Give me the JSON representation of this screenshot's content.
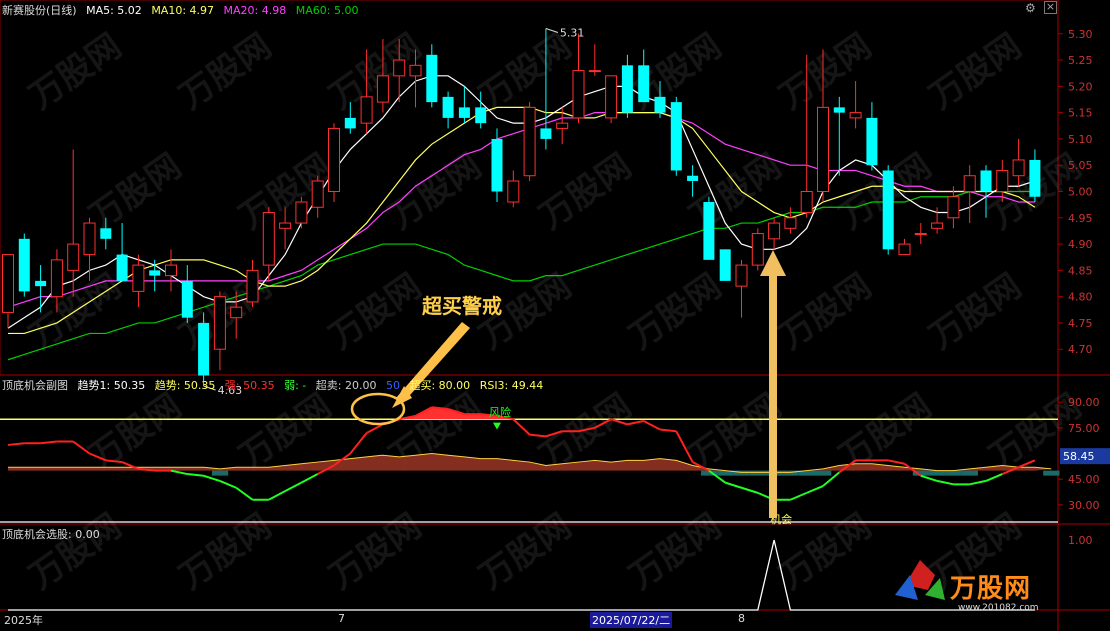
{
  "main_panel": {
    "title": "新赛股份(日线)",
    "ma5_label": "MA5: 5.02",
    "ma10_label": "MA10: 4.97",
    "ma20_label": "MA20: 4.98",
    "ma60_label": "MA60: 5.00",
    "price_ticks": [
      "5.30",
      "5.25",
      "5.20",
      "5.15",
      "5.10",
      "5.05",
      "5.00",
      "4.95",
      "4.90",
      "4.85",
      "4.80",
      "4.75",
      "4.70"
    ],
    "high_label": "5.31",
    "low_label": "4.63",
    "annotation_overbought": "超买警戒"
  },
  "sub_panel_1": {
    "title": "顶底机会副图",
    "label_trend1": "趋势1: 50.35",
    "label_trend": "趋势: 50.35",
    "label_strong": "强: 50.35",
    "label_weak": "弱: -",
    "label_oversold": "超卖: 20.00",
    "label_50": "50",
    "label_overbought": "超买: 80.00",
    "label_rsi3": "RSI3: 49.44",
    "ticks": [
      "90.00",
      "75.00",
      "45.00",
      "30.00"
    ],
    "current_value": "58.45",
    "signal_risk": "风险",
    "signal_chance": "机会"
  },
  "sub_panel_2": {
    "title": "顶底机会选股",
    "value": ": 0.00",
    "tick": "1.00"
  },
  "time_axis": {
    "label_year": "2025年",
    "label_7": "7",
    "label_date": "2025/07/22/二",
    "label_8": "8"
  },
  "watermark": {
    "brand": "万股网",
    "url": "www.201082.com"
  },
  "colors": {
    "up": "#ff3030",
    "down": "#00ffff",
    "ma5": "#ffffff",
    "ma10": "#ffff60",
    "ma20": "#ff40ff",
    "ma60": "#00d000"
  },
  "chart_data": [
    {
      "type": "candlestick",
      "title": "新赛股份(日线)",
      "ylim": [
        4.67,
        5.33
      ],
      "candles": [
        {
          "o": 4.77,
          "h": 4.88,
          "l": 4.74,
          "c": 4.88
        },
        {
          "o": 4.91,
          "h": 4.92,
          "l": 4.8,
          "c": 4.81
        },
        {
          "o": 4.83,
          "h": 4.86,
          "l": 4.77,
          "c": 4.82
        },
        {
          "o": 4.8,
          "h": 4.89,
          "l": 4.77,
          "c": 4.87
        },
        {
          "o": 4.85,
          "h": 5.08,
          "l": 4.8,
          "c": 4.9
        },
        {
          "o": 4.88,
          "h": 4.95,
          "l": 4.83,
          "c": 4.94
        },
        {
          "o": 4.93,
          "h": 4.95,
          "l": 4.89,
          "c": 4.91
        },
        {
          "o": 4.88,
          "h": 4.94,
          "l": 4.83,
          "c": 4.83
        },
        {
          "o": 4.81,
          "h": 4.88,
          "l": 4.78,
          "c": 4.86
        },
        {
          "o": 4.85,
          "h": 4.87,
          "l": 4.81,
          "c": 4.84
        },
        {
          "o": 4.84,
          "h": 4.89,
          "l": 4.81,
          "c": 4.86
        },
        {
          "o": 4.83,
          "h": 4.86,
          "l": 4.75,
          "c": 4.76
        },
        {
          "o": 4.75,
          "h": 4.77,
          "l": 4.63,
          "c": 4.65
        },
        {
          "o": 4.7,
          "h": 4.81,
          "l": 4.66,
          "c": 4.8
        },
        {
          "o": 4.76,
          "h": 4.81,
          "l": 4.72,
          "c": 4.78
        },
        {
          "o": 4.79,
          "h": 4.87,
          "l": 4.78,
          "c": 4.85
        },
        {
          "o": 4.86,
          "h": 4.97,
          "l": 4.83,
          "c": 4.96
        },
        {
          "o": 4.93,
          "h": 4.97,
          "l": 4.89,
          "c": 4.94
        },
        {
          "o": 4.94,
          "h": 4.99,
          "l": 4.93,
          "c": 4.98
        },
        {
          "o": 4.97,
          "h": 5.03,
          "l": 4.95,
          "c": 5.02
        },
        {
          "o": 5.0,
          "h": 5.13,
          "l": 4.98,
          "c": 5.12
        },
        {
          "o": 5.14,
          "h": 5.17,
          "l": 5.11,
          "c": 5.12
        },
        {
          "o": 5.13,
          "h": 5.27,
          "l": 5.11,
          "c": 5.18
        },
        {
          "o": 5.17,
          "h": 5.29,
          "l": 5.15,
          "c": 5.22
        },
        {
          "o": 5.22,
          "h": 5.29,
          "l": 5.17,
          "c": 5.25
        },
        {
          "o": 5.22,
          "h": 5.27,
          "l": 5.16,
          "c": 5.24
        },
        {
          "o": 5.26,
          "h": 5.28,
          "l": 5.16,
          "c": 5.17
        },
        {
          "o": 5.18,
          "h": 5.19,
          "l": 5.12,
          "c": 5.14
        },
        {
          "o": 5.16,
          "h": 5.2,
          "l": 5.13,
          "c": 5.14
        },
        {
          "o": 5.16,
          "h": 5.19,
          "l": 5.12,
          "c": 5.13
        },
        {
          "o": 5.1,
          "h": 5.12,
          "l": 4.98,
          "c": 5.0
        },
        {
          "o": 4.98,
          "h": 5.04,
          "l": 4.97,
          "c": 5.02
        },
        {
          "o": 5.03,
          "h": 5.17,
          "l": 5.02,
          "c": 5.16
        },
        {
          "o": 5.12,
          "h": 5.31,
          "l": 5.08,
          "c": 5.1
        },
        {
          "o": 5.12,
          "h": 5.16,
          "l": 5.09,
          "c": 5.13
        },
        {
          "o": 5.14,
          "h": 5.3,
          "l": 5.13,
          "c": 5.23
        },
        {
          "o": 5.23,
          "h": 5.28,
          "l": 5.22,
          "c": 5.23
        },
        {
          "o": 5.14,
          "h": 5.22,
          "l": 5.13,
          "c": 5.22
        },
        {
          "o": 5.24,
          "h": 5.26,
          "l": 5.14,
          "c": 5.15
        },
        {
          "o": 5.24,
          "h": 5.27,
          "l": 5.17,
          "c": 5.17
        },
        {
          "o": 5.18,
          "h": 5.21,
          "l": 5.14,
          "c": 5.15
        },
        {
          "o": 5.17,
          "h": 5.18,
          "l": 5.03,
          "c": 5.04
        },
        {
          "o": 5.03,
          "h": 5.05,
          "l": 4.99,
          "c": 5.02
        },
        {
          "o": 4.98,
          "h": 4.99,
          "l": 4.87,
          "c": 4.87
        },
        {
          "o": 4.89,
          "h": 4.89,
          "l": 4.83,
          "c": 4.83
        },
        {
          "o": 4.82,
          "h": 4.87,
          "l": 4.76,
          "c": 4.86
        },
        {
          "o": 4.86,
          "h": 4.93,
          "l": 4.85,
          "c": 4.92
        },
        {
          "o": 4.91,
          "h": 4.95,
          "l": 4.89,
          "c": 4.94
        },
        {
          "o": 4.93,
          "h": 4.97,
          "l": 4.92,
          "c": 4.95
        },
        {
          "o": 4.96,
          "h": 5.26,
          "l": 4.95,
          "c": 5.0
        },
        {
          "o": 5.0,
          "h": 5.27,
          "l": 4.98,
          "c": 5.16
        },
        {
          "o": 5.16,
          "h": 5.18,
          "l": 5.03,
          "c": 5.15
        },
        {
          "o": 5.14,
          "h": 5.21,
          "l": 5.12,
          "c": 5.15
        },
        {
          "o": 5.14,
          "h": 5.17,
          "l": 5.04,
          "c": 5.05
        },
        {
          "o": 5.04,
          "h": 5.05,
          "l": 4.88,
          "c": 4.89
        },
        {
          "o": 4.88,
          "h": 4.91,
          "l": 4.88,
          "c": 4.9
        },
        {
          "o": 4.92,
          "h": 4.94,
          "l": 4.9,
          "c": 4.92
        },
        {
          "o": 4.93,
          "h": 4.97,
          "l": 4.92,
          "c": 4.94
        },
        {
          "o": 4.95,
          "h": 5.01,
          "l": 4.93,
          "c": 4.99
        },
        {
          "o": 5.0,
          "h": 5.05,
          "l": 4.94,
          "c": 5.03
        },
        {
          "o": 5.04,
          "h": 5.05,
          "l": 4.95,
          "c": 5.0
        },
        {
          "o": 5.0,
          "h": 5.06,
          "l": 4.98,
          "c": 5.04
        },
        {
          "o": 5.03,
          "h": 5.1,
          "l": 5.01,
          "c": 5.06
        },
        {
          "o": 5.06,
          "h": 5.08,
          "l": 4.98,
          "c": 4.99
        }
      ],
      "ma5": [
        4.74,
        4.76,
        4.78,
        4.82,
        4.83,
        4.85,
        4.86,
        4.88,
        4.87,
        4.86,
        4.84,
        4.82,
        4.8,
        4.79,
        4.79,
        4.8,
        4.84,
        4.88,
        4.94,
        4.99,
        5.04,
        5.08,
        5.11,
        5.14,
        5.18,
        5.21,
        5.22,
        5.22,
        5.2,
        5.17,
        5.14,
        5.13,
        5.13,
        5.14,
        5.16,
        5.18,
        5.19,
        5.2,
        5.2,
        5.18,
        5.17,
        5.15,
        5.08,
        5.01,
        4.94,
        4.9,
        4.89,
        4.89,
        4.9,
        4.93,
        5.0,
        5.04,
        5.06,
        5.05,
        5.02,
        4.99,
        4.97,
        4.96,
        4.96,
        4.97,
        4.99,
        5.01,
        5.01,
        5.02
      ],
      "ma10": [
        4.73,
        4.73,
        4.74,
        4.75,
        4.77,
        4.79,
        4.81,
        4.83,
        4.85,
        4.86,
        4.87,
        4.87,
        4.87,
        4.86,
        4.85,
        4.83,
        4.82,
        4.82,
        4.83,
        4.85,
        4.88,
        4.91,
        4.94,
        4.98,
        5.02,
        5.06,
        5.09,
        5.11,
        5.13,
        5.15,
        5.16,
        5.16,
        5.16,
        5.15,
        5.15,
        5.14,
        5.14,
        5.15,
        5.15,
        5.15,
        5.15,
        5.14,
        5.12,
        5.08,
        5.04,
        5.0,
        4.98,
        4.96,
        4.95,
        4.96,
        4.98,
        4.99,
        5.0,
        5.01,
        5.01,
        5.0,
        5.0,
        5.0,
        5.0,
        5.0,
        5.0,
        5.0,
        4.99,
        4.97
      ],
      "ma20": [
        4.78,
        4.79,
        4.8,
        4.8,
        4.81,
        4.82,
        4.83,
        4.83,
        4.83,
        4.83,
        4.83,
        4.83,
        4.83,
        4.83,
        4.83,
        4.83,
        4.83,
        4.84,
        4.85,
        4.87,
        4.89,
        4.91,
        4.93,
        4.96,
        4.98,
        5.01,
        5.03,
        5.05,
        5.07,
        5.08,
        5.1,
        5.11,
        5.12,
        5.13,
        5.14,
        5.14,
        5.15,
        5.15,
        5.15,
        5.15,
        5.15,
        5.14,
        5.13,
        5.11,
        5.09,
        5.08,
        5.07,
        5.06,
        5.05,
        5.05,
        5.04,
        5.04,
        5.04,
        5.03,
        5.02,
        5.01,
        5.01,
        5.0,
        5.0,
        5.0,
        4.99,
        4.99,
        4.98,
        4.98
      ],
      "ma60": [
        4.68,
        4.69,
        4.7,
        4.71,
        4.72,
        4.73,
        4.73,
        4.74,
        4.75,
        4.75,
        4.76,
        4.77,
        4.78,
        4.79,
        4.8,
        4.81,
        4.82,
        4.83,
        4.84,
        4.86,
        4.87,
        4.88,
        4.89,
        4.9,
        4.9,
        4.9,
        4.89,
        4.88,
        4.86,
        4.85,
        4.84,
        4.83,
        4.83,
        4.84,
        4.84,
        4.85,
        4.86,
        4.87,
        4.88,
        4.89,
        4.9,
        4.91,
        4.92,
        4.93,
        4.93,
        4.94,
        4.94,
        4.95,
        4.96,
        4.96,
        4.97,
        4.97,
        4.97,
        4.98,
        4.98,
        4.98,
        4.99,
        4.99,
        4.99,
        5.0,
        5.0,
        5.0,
        5.0,
        5.0
      ]
    },
    {
      "type": "line",
      "title": "顶底机会副图",
      "ylim": [
        20,
        100
      ],
      "overbought": 80,
      "oversold": 20,
      "rsi": [
        65,
        66,
        66,
        67,
        67,
        60,
        56,
        55,
        51,
        50,
        50,
        48,
        47,
        44,
        40,
        33,
        33,
        38,
        43,
        48,
        53,
        60,
        72,
        77,
        80,
        82,
        87,
        86,
        83,
        83,
        82,
        80,
        71,
        70,
        73,
        73,
        75,
        80,
        77,
        79,
        74,
        73,
        55,
        50,
        43,
        40,
        37,
        33,
        33,
        37,
        41,
        49,
        56,
        56,
        56,
        54,
        47,
        44,
        42,
        42,
        44,
        48,
        52,
        56,
        55
      ],
      "trend_area": [
        52,
        52,
        52,
        52,
        52,
        52,
        52,
        52,
        52,
        52,
        52,
        52,
        52,
        51,
        52,
        52,
        52,
        53,
        54,
        55,
        56,
        57,
        58,
        59,
        58,
        59,
        60,
        59,
        58,
        57,
        57,
        56,
        55,
        53,
        54,
        55,
        56,
        55,
        56,
        56,
        57,
        56,
        53,
        51,
        50,
        49,
        49,
        49,
        49,
        50,
        51,
        53,
        54,
        54,
        53,
        52,
        51,
        50,
        50,
        51,
        52,
        53,
        52,
        52,
        51
      ]
    },
    {
      "type": "line",
      "title": "顶底机会选股",
      "ylim": [
        0,
        1
      ],
      "values": [
        0,
        0,
        0,
        0,
        0,
        0,
        0,
        0,
        0,
        0,
        0,
        0,
        0,
        0,
        0,
        0,
        0,
        0,
        0,
        0,
        0,
        0,
        0,
        0,
        0,
        0,
        0,
        0,
        0,
        0,
        0,
        0,
        0,
        0,
        0,
        0,
        0,
        0,
        0,
        0,
        0,
        0,
        0,
        0,
        0,
        0,
        0,
        1,
        0,
        0,
        0,
        0,
        0,
        0,
        0,
        0,
        0,
        0,
        0,
        0,
        0,
        0,
        0,
        0
      ]
    }
  ]
}
